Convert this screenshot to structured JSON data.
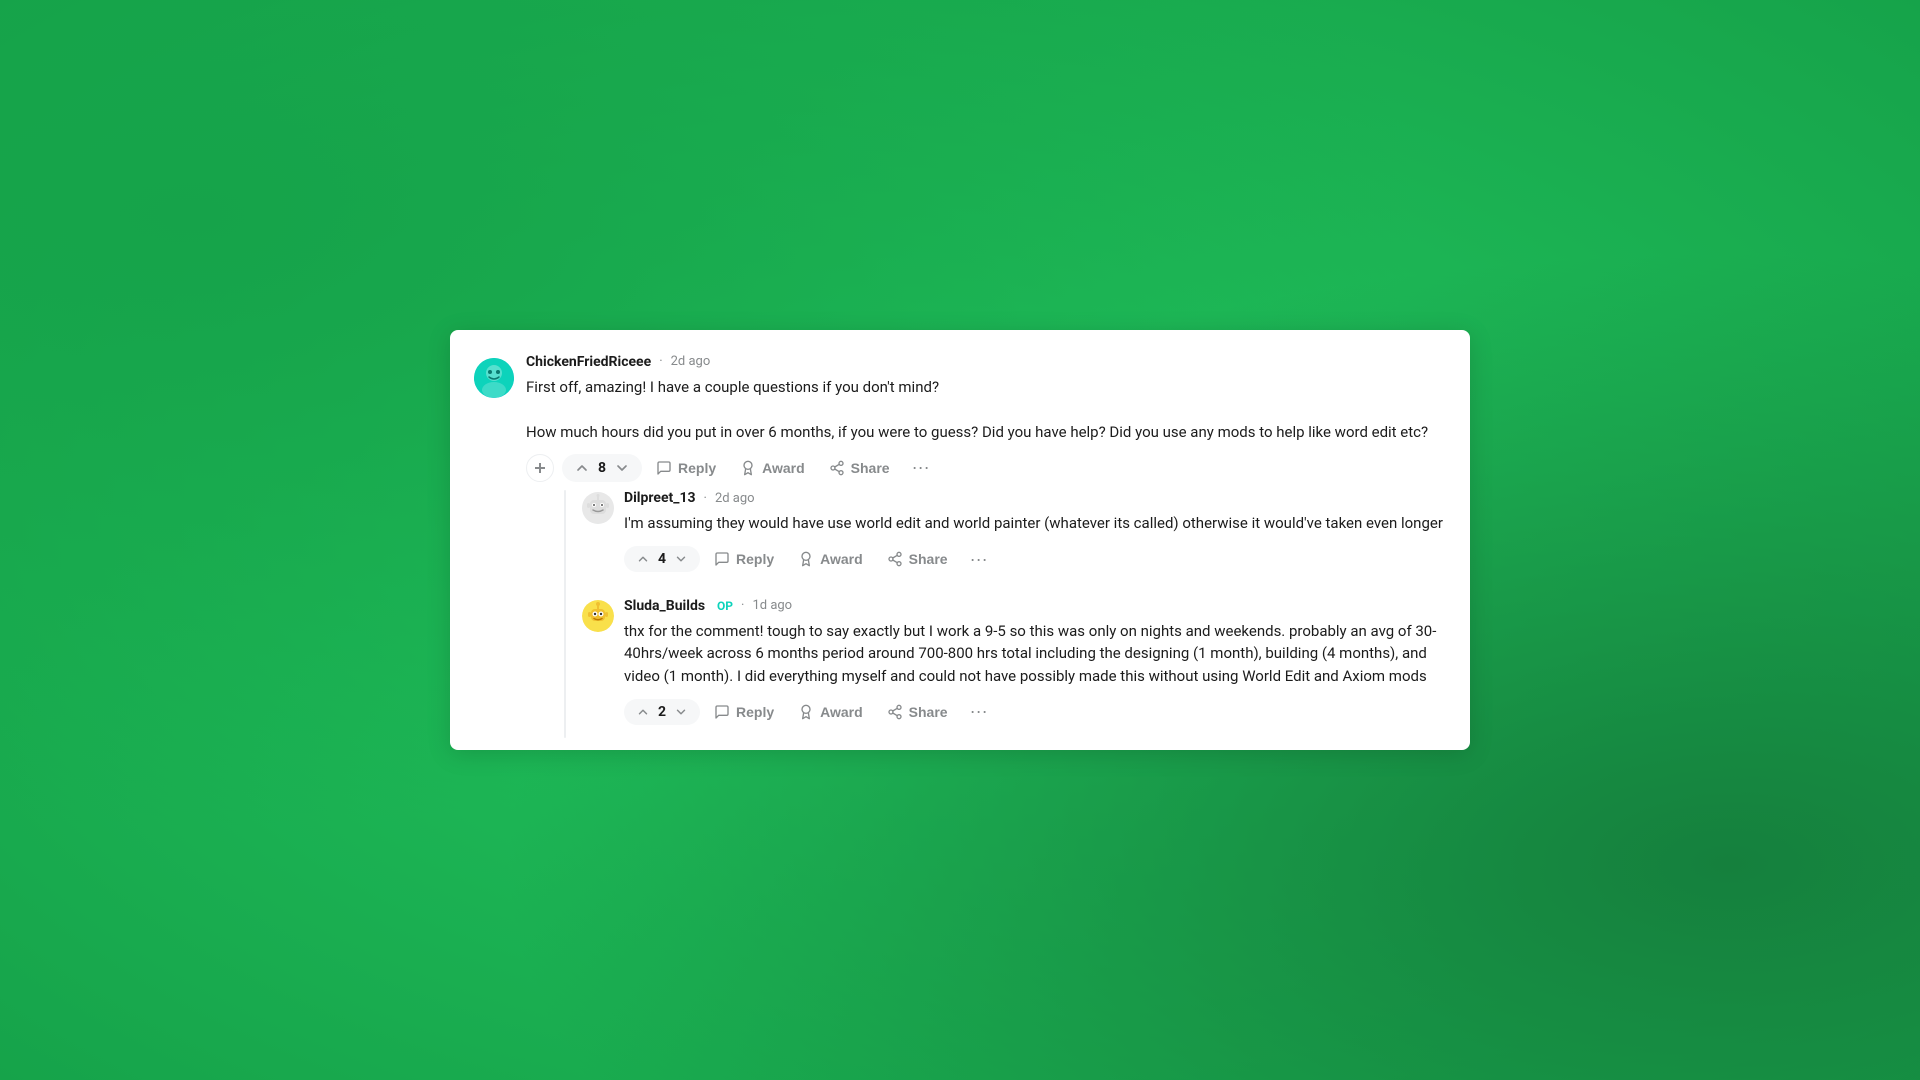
{
  "background": {
    "color": "#22c55e"
  },
  "comments": [
    {
      "id": "comment-1",
      "username": "ChickenFriedRiceee",
      "timestamp": "2d ago",
      "op": false,
      "avatar_type": "chicken",
      "vote_count": "8",
      "text_lines": [
        "First off, amazing! I have a couple questions if you don't mind?",
        "How much hours did you put in over 6 months, if you were to guess? Did you have help? Did you use any mods to help like word edit etc?"
      ],
      "actions": {
        "reply": "Reply",
        "award": "Award",
        "share": "Share"
      },
      "replies": [
        {
          "id": "reply-1",
          "username": "Dilpreet_13",
          "timestamp": "2d ago",
          "op": false,
          "avatar_type": "dilpreet",
          "vote_count": "4",
          "text": "I'm assuming they would have use world edit and world painter (whatever its called) otherwise it would've taken even longer",
          "actions": {
            "reply": "Reply",
            "award": "Award",
            "share": "Share"
          }
        },
        {
          "id": "reply-2",
          "username": "Sluda_Builds",
          "timestamp": "1d ago",
          "op": true,
          "op_label": "OP",
          "avatar_type": "sluda",
          "vote_count": "2",
          "text": "thx for the comment! tough to say exactly but I work a 9-5 so this was only on nights and weekends. probably an avg of 30-40hrs/week across 6 months period around 700-800 hrs total including the designing (1 month), building (4 months), and video (1 month). I did everything myself and could not have possibly made this without using World Edit and Axiom mods",
          "actions": {
            "reply": "Reply",
            "award": "Award",
            "share": "Share"
          }
        }
      ]
    }
  ],
  "actions": {
    "reply_label": "Reply",
    "award_label": "Award",
    "share_label": "Share"
  }
}
